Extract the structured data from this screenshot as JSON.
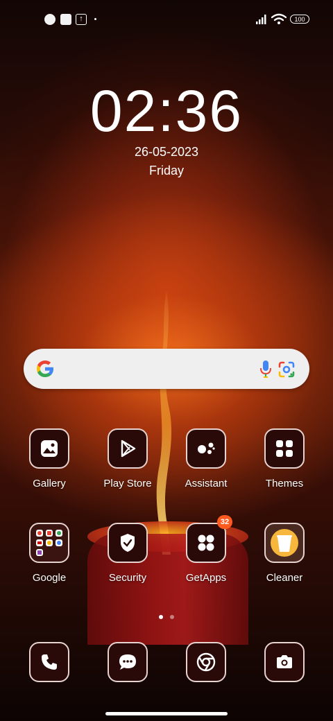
{
  "status_bar": {
    "icons": [
      "notification-app-icon",
      "notification-square-icon",
      "upload-icon",
      "dot-icon",
      "signal-icon",
      "wifi-icon"
    ],
    "battery": "100"
  },
  "lock_clock": {
    "time": "02:36",
    "date": "26-05-2023",
    "day": "Friday"
  },
  "search_bar": {
    "icons": [
      "google-logo-icon",
      "microphone-icon",
      "google-lens-icon"
    ]
  },
  "apps": {
    "row1": [
      {
        "label": "Gallery",
        "icon": "gallery-icon"
      },
      {
        "label": "Play Store",
        "icon": "play-store-icon"
      },
      {
        "label": "Assistant",
        "icon": "assistant-icon"
      },
      {
        "label": "Themes",
        "icon": "themes-icon"
      }
    ],
    "row2": [
      {
        "label": "Google",
        "icon": "google-folder-icon"
      },
      {
        "label": "Security",
        "icon": "security-shield-icon"
      },
      {
        "label": "GetApps",
        "icon": "getapps-icon",
        "badge": "32"
      },
      {
        "label": "Cleaner",
        "icon": "cleaner-icon"
      }
    ]
  },
  "pager": {
    "pages": 2,
    "current": 1
  },
  "dock": [
    {
      "icon": "phone-icon"
    },
    {
      "icon": "messages-icon"
    },
    {
      "icon": "chrome-icon"
    },
    {
      "icon": "camera-icon"
    }
  ],
  "colors": {
    "accent_badge": "#ff5a1f",
    "tile_bg": "#2a0a08",
    "tile_border": "#e7d3cf"
  }
}
